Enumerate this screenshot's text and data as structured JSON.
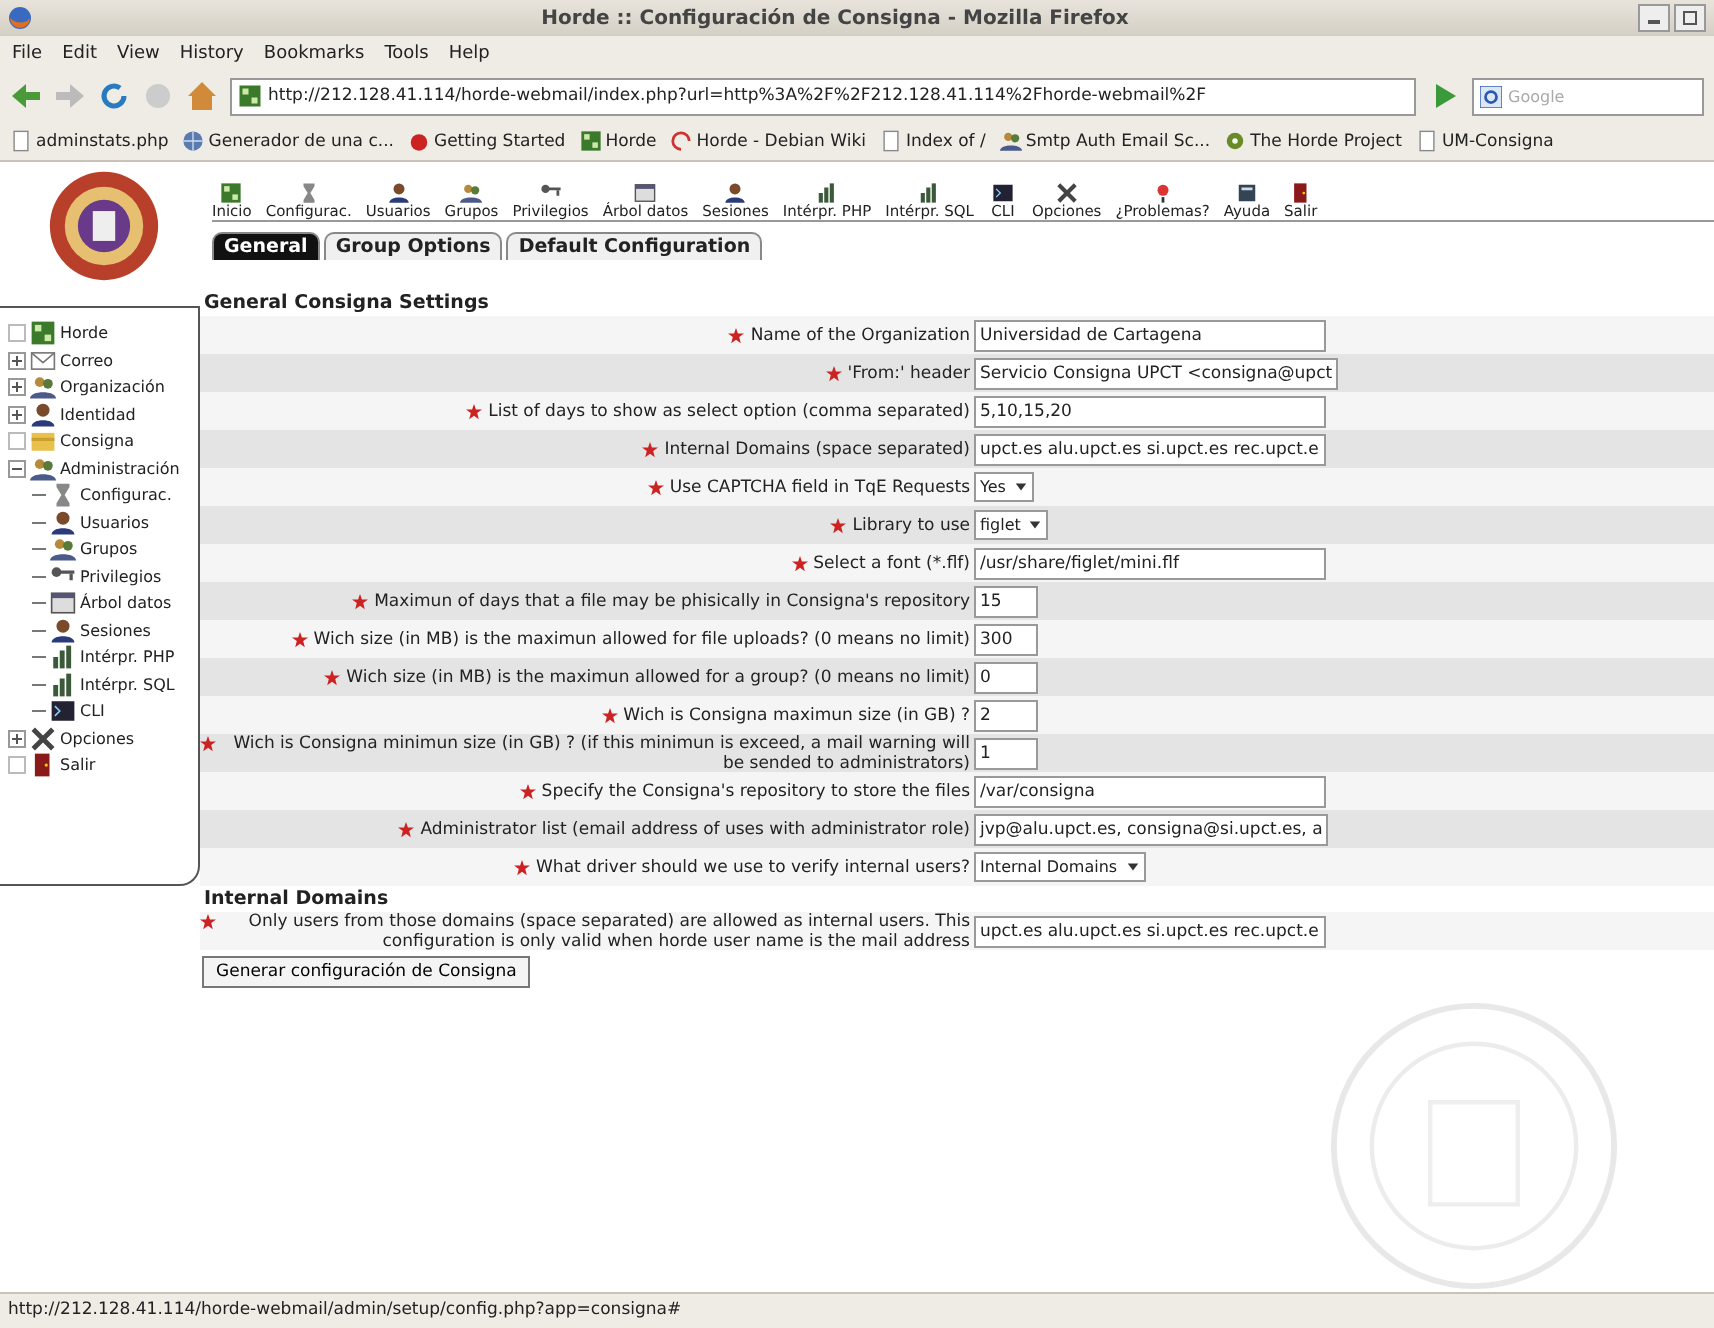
{
  "window": {
    "title": "Horde :: Configuración de Consigna - Mozilla Firefox"
  },
  "menu": [
    "File",
    "Edit",
    "View",
    "History",
    "Bookmarks",
    "Tools",
    "Help"
  ],
  "address": {
    "value": "http://212.128.41.114/horde-webmail/index.php?url=http%3A%2F%2F212.128.41.114%2Fhorde-webmail%2F"
  },
  "search": {
    "placeholder": "Google"
  },
  "bookmarks": [
    "adminstats.php",
    "Generador de una c...",
    "Getting Started",
    "Horde",
    "Horde - Debian Wiki",
    "Index of /",
    "Smtp Auth Email Sc...",
    "The Horde Project",
    "UM-Consigna"
  ],
  "toolbar": [
    "Inicio",
    "Configurac.",
    "Usuarios",
    "Grupos",
    "Privilegios",
    "Árbol datos",
    "Sesiones",
    "Intérpr. PHP",
    "Intérpr. SQL",
    "CLI",
    "Opciones",
    "¿Problemas?",
    "Ayuda",
    "Salir"
  ],
  "tabs": [
    {
      "label": "General",
      "selected": true
    },
    {
      "label": "Group Options",
      "selected": false
    },
    {
      "label": "Default Configuration",
      "selected": false
    }
  ],
  "sidebar": {
    "items": [
      {
        "label": "Horde",
        "kind": "leaf"
      },
      {
        "label": "Correo",
        "kind": "folder",
        "expanded": false
      },
      {
        "label": "Organización",
        "kind": "folder",
        "expanded": false
      },
      {
        "label": "Identidad",
        "kind": "folder",
        "expanded": false
      },
      {
        "label": "Consigna",
        "kind": "leaf"
      },
      {
        "label": "Administración",
        "kind": "folder",
        "expanded": true,
        "children": [
          {
            "label": "Configurac."
          },
          {
            "label": "Usuarios"
          },
          {
            "label": "Grupos"
          },
          {
            "label": "Privilegios"
          },
          {
            "label": "Árbol datos"
          },
          {
            "label": "Sesiones"
          },
          {
            "label": "Intérpr. PHP"
          },
          {
            "label": "Intérpr. SQL"
          },
          {
            "label": "CLI"
          }
        ]
      },
      {
        "label": "Opciones",
        "kind": "folder",
        "expanded": false
      },
      {
        "label": "Salir",
        "kind": "leaf"
      }
    ]
  },
  "sections": [
    {
      "title": "General Consigna Settings",
      "rows": [
        {
          "label": "Name of the Organization",
          "kind": "text",
          "value": "Universidad de Cartagena"
        },
        {
          "label": "'From:' header",
          "kind": "text",
          "value": "Servicio Consigna UPCT <consigna@upct"
        },
        {
          "label": "List of days to show as select option (comma separated)",
          "kind": "text",
          "value": "5,10,15,20"
        },
        {
          "label": "Internal Domains (space separated)",
          "kind": "text",
          "value": "upct.es alu.upct.es si.upct.es rec.upct.e"
        },
        {
          "label": "Use CAPTCHA field in TqE Requests",
          "kind": "select",
          "value": "Yes"
        },
        {
          "label": "Library to use",
          "kind": "select",
          "value": "figlet"
        },
        {
          "label": "Select a font (*.flf)",
          "kind": "text",
          "value": "/usr/share/figlet/mini.flf"
        },
        {
          "label": "Maximun of days that a file may be phisically in Consigna's repository",
          "kind": "number",
          "value": "15"
        },
        {
          "label": "Wich size (in MB) is the maximun allowed for file uploads? (0 means no limit)",
          "kind": "number",
          "value": "300"
        },
        {
          "label": "Wich size (in MB) is the maximun allowed for a group? (0 means no limit)",
          "kind": "number",
          "value": "0"
        },
        {
          "label": "Wich is Consigna maximun size (in GB) ?",
          "kind": "number",
          "value": "2"
        },
        {
          "label": "Wich is Consigna minimun size (in GB) ? (if this minimun is exceed, a mail warning will be sended to administrators)",
          "kind": "number",
          "value": "1"
        },
        {
          "label": "Specify the Consigna's repository to store the files",
          "kind": "text",
          "value": "/var/consigna"
        },
        {
          "label": "Administrator list (email address of uses with administrator role)",
          "kind": "text",
          "value": "jvp@alu.upct.es, consigna@si.upct.es, a"
        },
        {
          "label": "What driver should we use to verify internal users?",
          "kind": "select",
          "value": "Internal Domains"
        }
      ]
    },
    {
      "title": "Internal Domains",
      "rows": [
        {
          "label": "Only users from those domains (space separated) are allowed as internal users. This configuration is only valid when horde user name is the mail address",
          "kind": "text",
          "value": "upct.es alu.upct.es si.upct.es rec.upct.e"
        }
      ]
    }
  ],
  "submit": "Generar configuración de Consigna",
  "status_bar": "http://212.128.41.114/horde-webmail/admin/setup/config.php?app=consigna#"
}
